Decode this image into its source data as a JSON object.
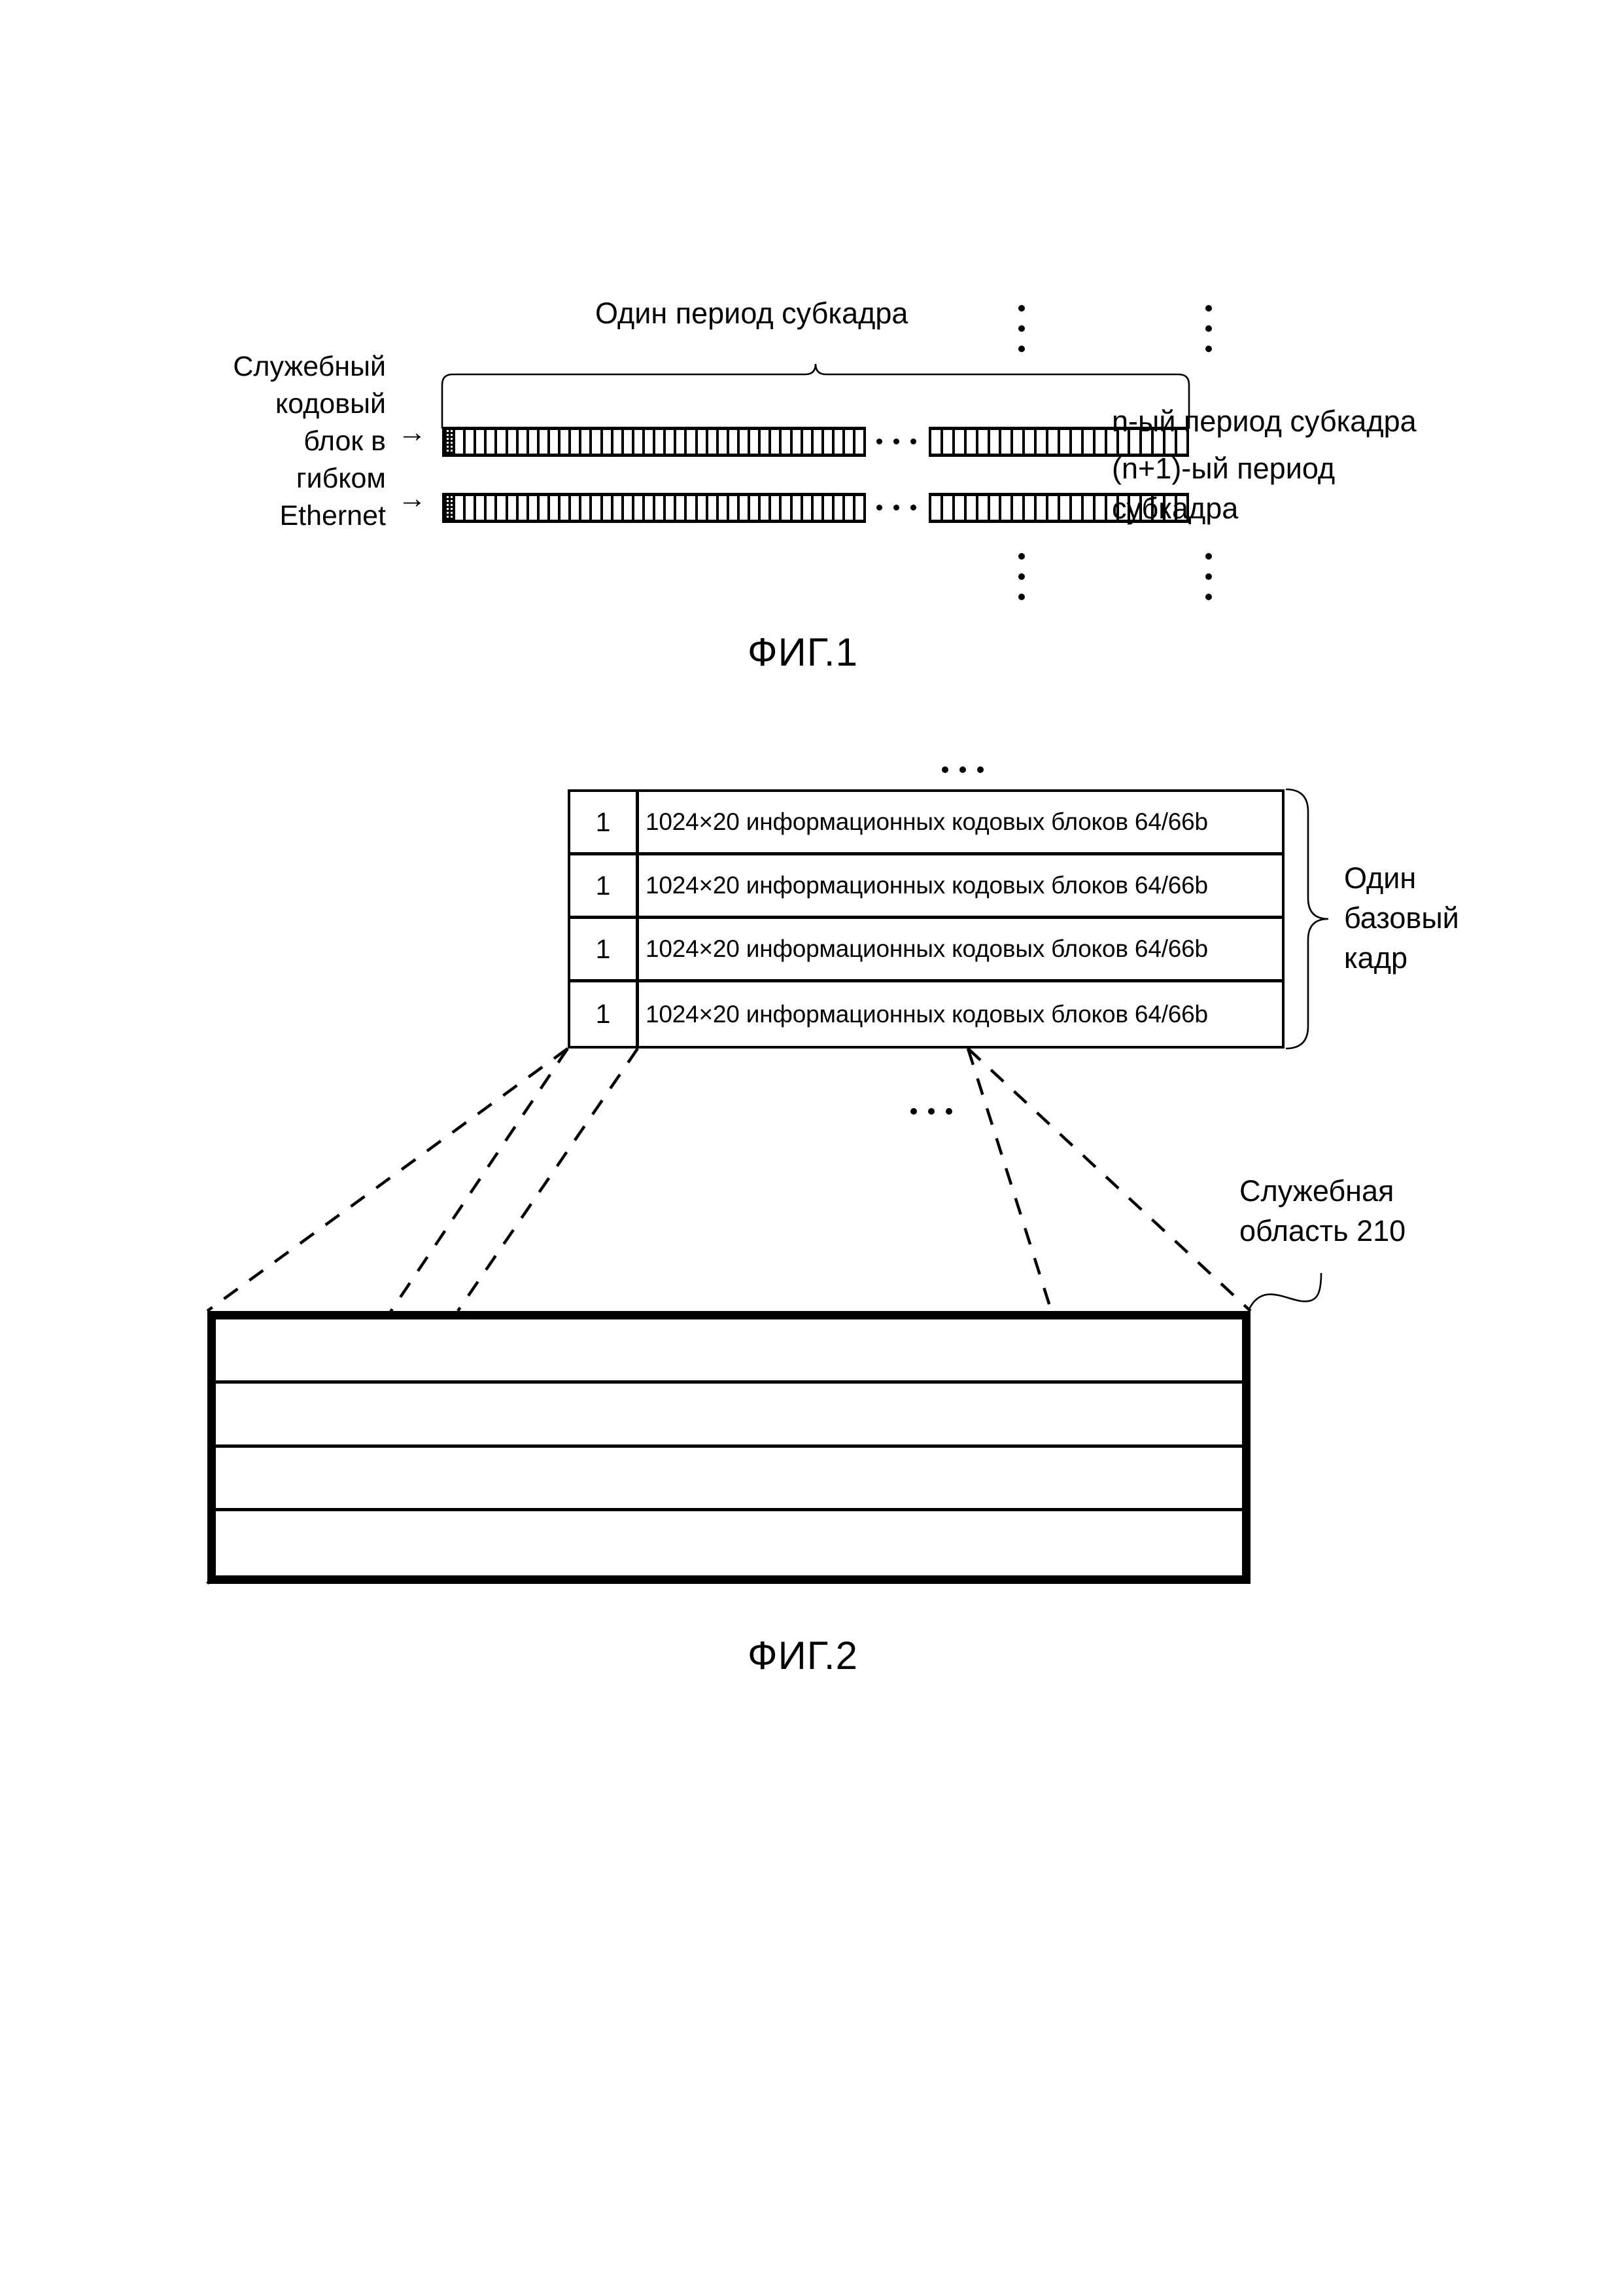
{
  "figure1": {
    "caption": "ФИГ.1",
    "top_label": "Один период субкадра",
    "left_label_lines": [
      "Служебный",
      "кодовый",
      "блок в",
      "гибком",
      "Ethernet"
    ],
    "arrow_glyph": "→",
    "right_labels": {
      "line1": "n-ый период субкадра",
      "line2": "(n+1)-ый период",
      "line3": "субкадра"
    },
    "row_gap_glyph": "...",
    "vertical_ellipsis_glyph": "⋮",
    "bars": [
      {
        "name": "subframe-period-n",
        "left_cells": 40,
        "right_cells": 22,
        "has_overhead_block": true
      },
      {
        "name": "subframe-period-n-plus1",
        "left_cells": 40,
        "right_cells": 22,
        "has_overhead_block": true
      }
    ]
  },
  "figure2": {
    "caption": "ФИГ.2",
    "top_ellipsis": "...",
    "bottom_ellipsis": "...",
    "table_rows": [
      {
        "num": "1",
        "text": "1024×20 информационных кодовых блоков 64/66b"
      },
      {
        "num": "1",
        "text": "1024×20 информационных кодовых блоков 64/66b"
      },
      {
        "num": "1",
        "text": "1024×20 информационных кодовых блоков 64/66b"
      },
      {
        "num": "1",
        "text": "1024×20 информационных кодовых блоков 64/66b"
      }
    ],
    "brace_label_lines": [
      "Один",
      "базовый",
      "кадр"
    ],
    "overhead_label_lines": [
      "Служебная",
      "область 210"
    ],
    "overhead_reference_number": "210",
    "big_frame_rows": 4
  },
  "colors": {
    "ink": "#000000",
    "paper": "#ffffff"
  }
}
